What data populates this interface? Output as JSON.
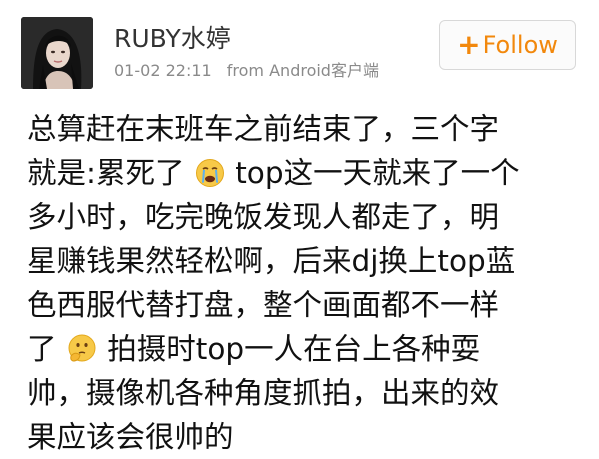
{
  "user": {
    "name": "RUBY水婷",
    "avatar_icon": "user-avatar-photo"
  },
  "meta": {
    "time": "01-02 22:11",
    "source": "from Android客户端"
  },
  "follow_button": {
    "plus": "+",
    "label": "Follow",
    "color": "#f2880c"
  },
  "post": {
    "lines": [
      {
        "text_before": "总算赶在末班车之前结束了，三个字",
        "emoji": "",
        "text_after": ""
      },
      {
        "text_before": "就是:累死了",
        "emoji": "crying-face-icon",
        "text_after": "top这一天就来了一个"
      },
      {
        "text_before": "多小时，吃完晚饭发现人都走了，明",
        "emoji": "",
        "text_after": ""
      },
      {
        "text_before": "星赚钱果然轻松啊，后来dj换上top蓝",
        "emoji": "",
        "text_after": ""
      },
      {
        "text_before": "色西服代替打盘，整个画面都不一样",
        "emoji": "",
        "text_after": ""
      },
      {
        "text_before": "了",
        "emoji": "thinking-face-icon",
        "text_after": "拍摄时top一人在台上各种耍"
      },
      {
        "text_before": "帅，摄像机各种角度抓拍，出来的效",
        "emoji": "",
        "text_after": ""
      },
      {
        "text_before": "果应该会很帅的",
        "emoji": "",
        "text_after": ""
      }
    ]
  }
}
